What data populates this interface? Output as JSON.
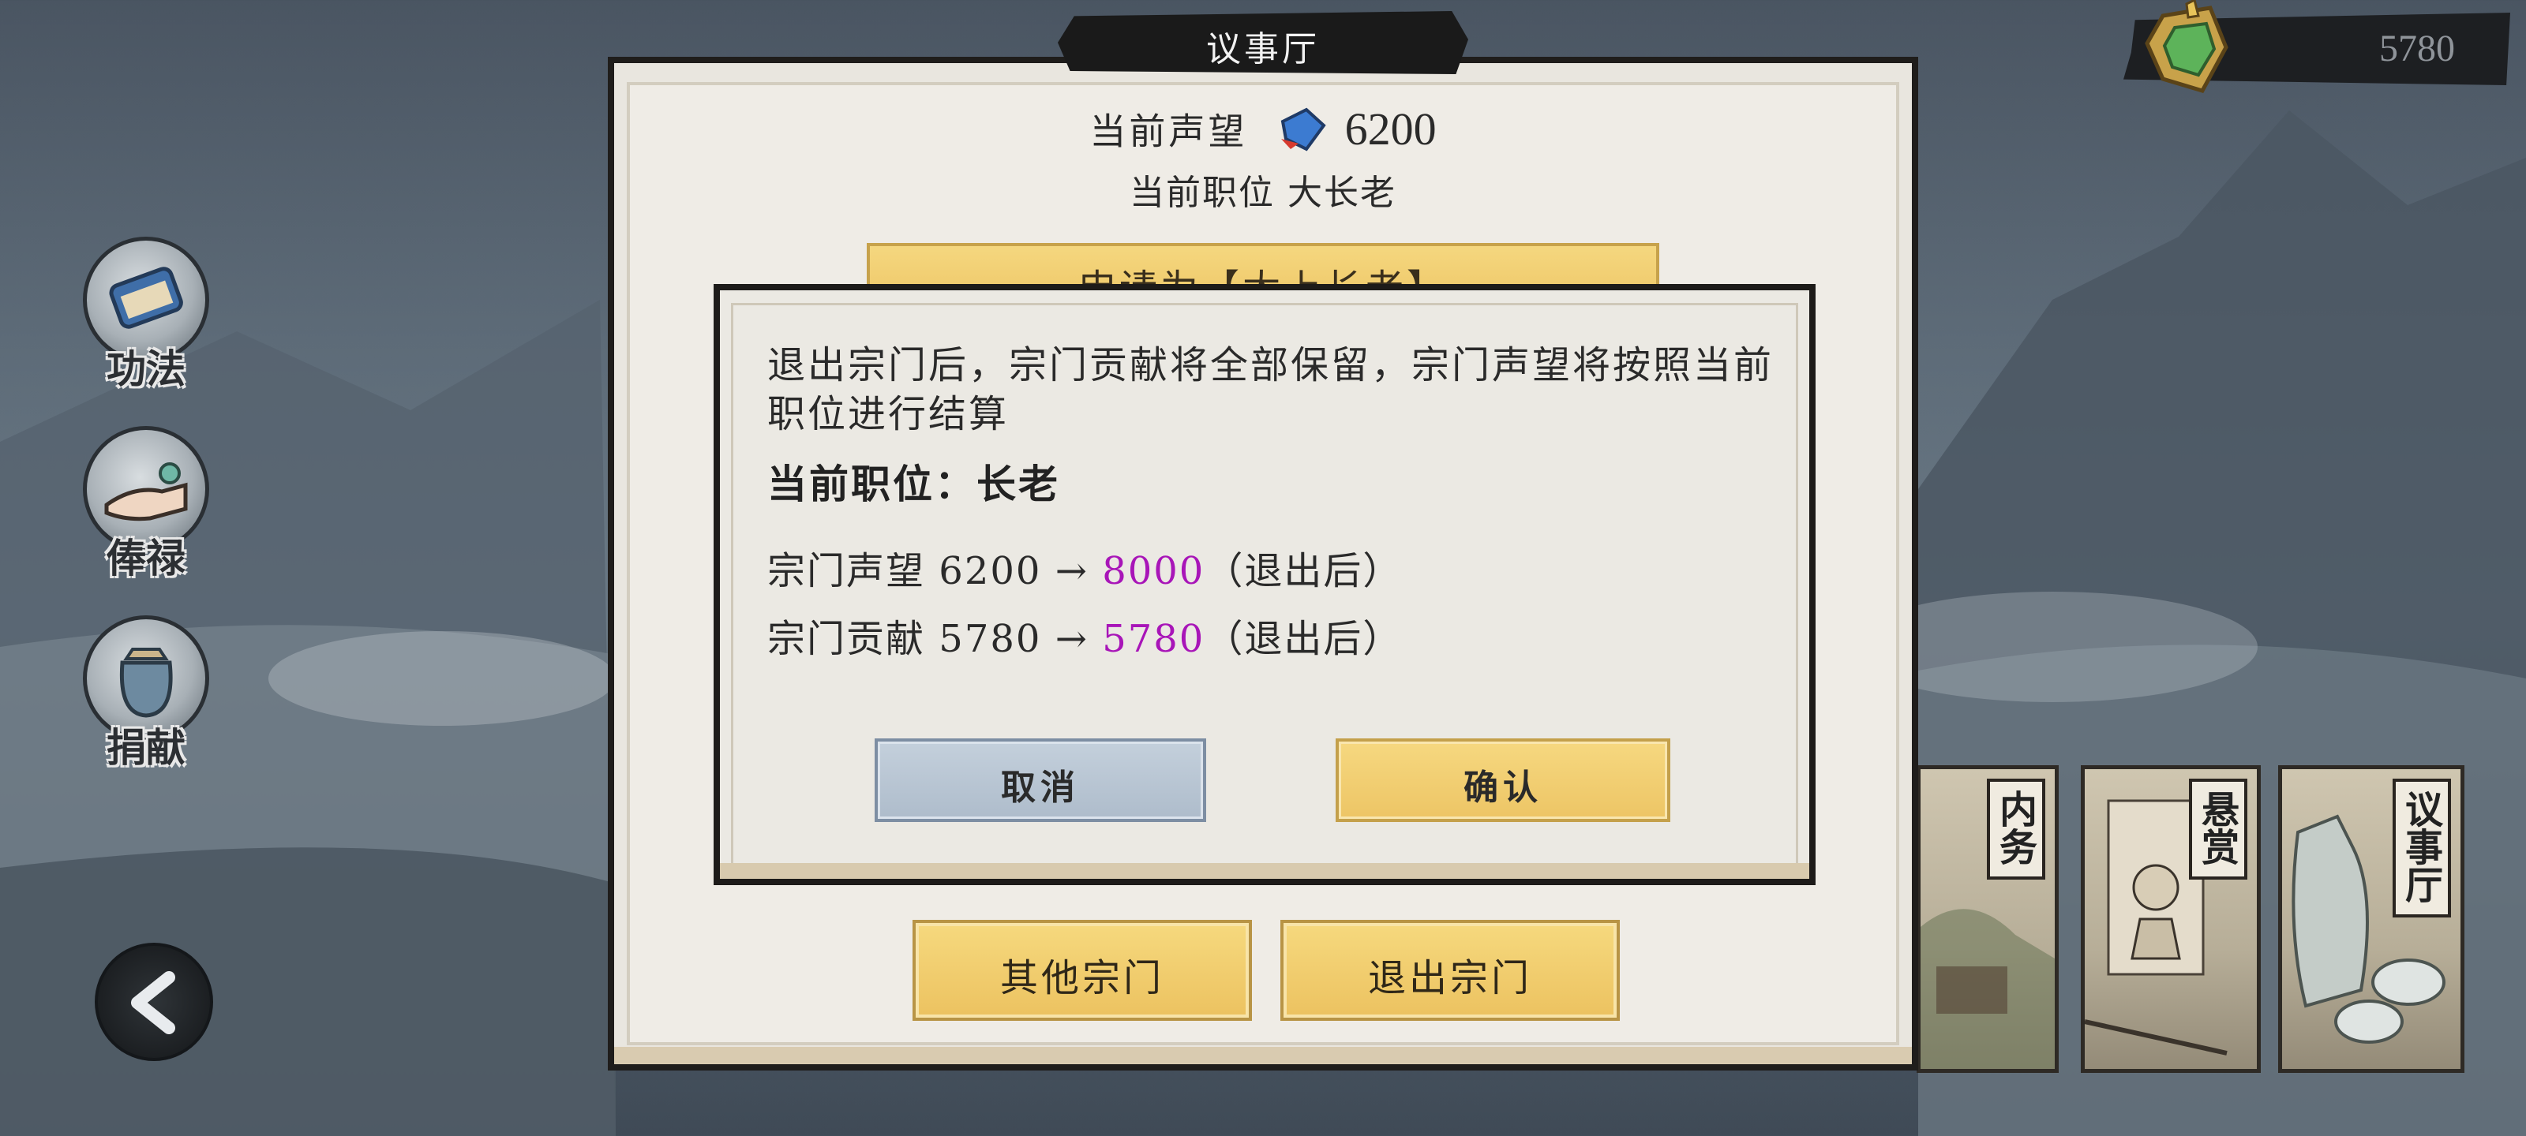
{
  "header": {
    "title": "议事厅",
    "currency_value": "5780"
  },
  "side_menu": [
    {
      "label": "功法",
      "icon": "scroll-icon"
    },
    {
      "label": "俸禄",
      "icon": "hand-icon"
    },
    {
      "label": "捐献",
      "icon": "pouch-icon"
    }
  ],
  "panel": {
    "reputation_label": "当前声望",
    "reputation_value": "6200",
    "position_text": "当前职位 大长老",
    "apply_label": "申请为【太上长老】",
    "other_sect_label": "其他宗门",
    "leave_sect_label": "退出宗门"
  },
  "dialog": {
    "message": "退出宗门后，宗门贡献将全部保留，宗门声望将按照当前职位进行结算",
    "position_line": "当前职位：长老",
    "reputation_line": {
      "label": "宗门声望",
      "from": "6200",
      "arrow": "→",
      "to": "8000",
      "suffix": "（退出后）"
    },
    "contribution_line": {
      "label": "宗门贡献",
      "from": "5780",
      "arrow": "→",
      "to": "5780",
      "suffix": "（退出后）"
    },
    "cancel_label": "取消",
    "confirm_label": "确认"
  },
  "cards": [
    {
      "label": "内务"
    },
    {
      "label": "悬赏"
    },
    {
      "label": "议事厅"
    }
  ],
  "colors": {
    "highlight": "#a815b8",
    "button_gold": "#edc564",
    "button_blue": "#aebccb"
  }
}
